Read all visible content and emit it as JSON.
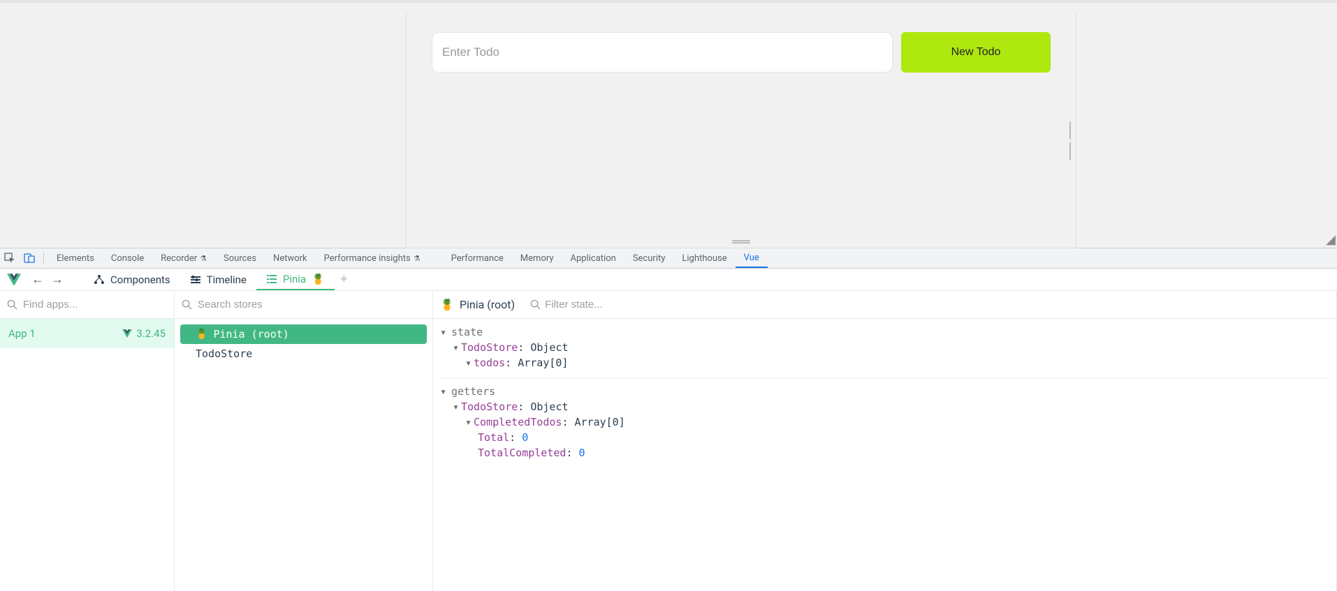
{
  "app": {
    "todo_placeholder": "Enter Todo",
    "new_todo_label": "New Todo"
  },
  "devtools_tabs": {
    "elements": "Elements",
    "console": "Console",
    "recorder": "Recorder",
    "sources": "Sources",
    "network": "Network",
    "perf_insights": "Performance insights",
    "performance": "Performance",
    "memory": "Memory",
    "application": "Application",
    "security": "Security",
    "lighthouse": "Lighthouse",
    "vue": "Vue"
  },
  "vue_bar": {
    "components": "Components",
    "timeline": "Timeline",
    "pinia": "Pinia"
  },
  "apps_panel": {
    "placeholder": "Find apps...",
    "app_name": "App 1",
    "version": "3.2.45"
  },
  "stores_panel": {
    "placeholder": "Search stores",
    "root": "Pinia (root)",
    "store1": "TodoStore"
  },
  "state_panel": {
    "title": "Pinia (root)",
    "filter_placeholder": "Filter state...",
    "state_heading": "state",
    "getters_heading": "getters",
    "todostore_label": "TodoStore",
    "object_label": "Object",
    "todos_label": "todos",
    "array0_label": "Array[0]",
    "completed_label": "CompletedTodos",
    "total_label": "Total",
    "total_value": "0",
    "total_completed_label": "TotalCompleted",
    "total_completed_value": "0"
  }
}
